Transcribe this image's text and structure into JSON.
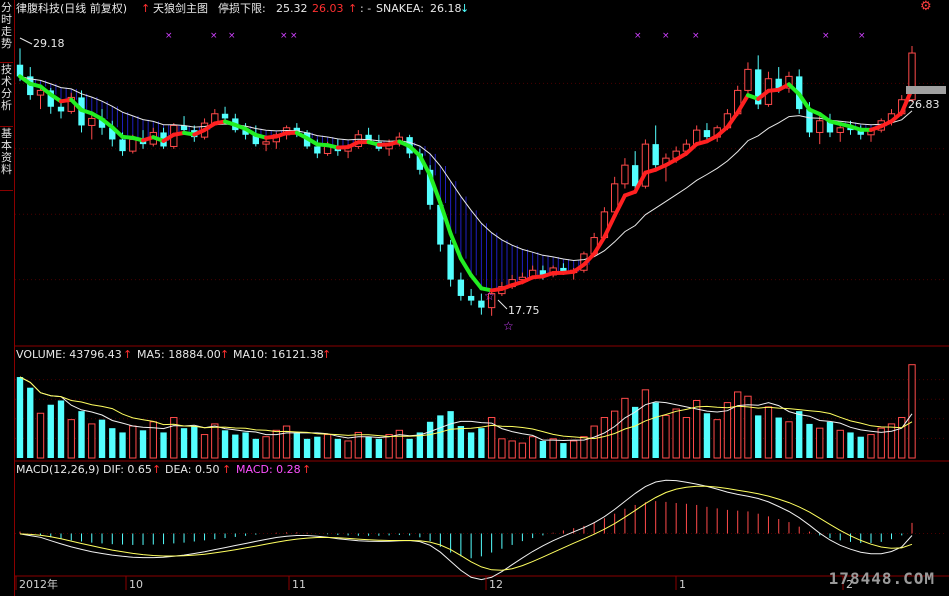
{
  "header": {
    "stock": "律腹科技(日线 前复权)",
    "indicator": "天狼剑主图",
    "stop_label": "停损下限:",
    "stop_value": "25.32",
    "stop_value2": "26.03",
    "snake_label": "SNAKEA:",
    "snake_value": "26.18"
  },
  "side_tabs": [
    "分时走势",
    "技术分析",
    "基本资料"
  ],
  "price_labels": {
    "high": "29.18",
    "low": "17.75",
    "last": "26.83"
  },
  "volume_header": {
    "volume": "VOLUME: 43796.43",
    "ma5": "MA5: 18884.00",
    "ma10": "MA10: 16121.38"
  },
  "macd_header": {
    "title": "MACD(12,26,9)",
    "dif": "DIF: 0.65",
    "dea": "DEA: 0.50",
    "macd": "MACD: 0.28"
  },
  "x_axis": {
    "labels": [
      "2012年",
      "10",
      "11",
      "12",
      "1",
      "2"
    ]
  },
  "watermark": "178448.COM",
  "colors": {
    "up": "#ff4a4a",
    "down": "#54ffff",
    "line": "#e8e8e8",
    "bull": "#ff2020",
    "bear": "#22ee22",
    "frame": "#8a0000"
  },
  "chart_data": [
    {
      "type": "candlestick",
      "title": "天狼剑主图",
      "ylim": [
        16.5,
        30.5
      ],
      "ohlc": [
        [
          28.5,
          29.2,
          27.8,
          28.0
        ],
        [
          28.0,
          28.4,
          27.0,
          27.2
        ],
        [
          27.2,
          27.6,
          26.6,
          27.4
        ],
        [
          27.4,
          27.5,
          26.4,
          26.7
        ],
        [
          26.7,
          27.0,
          26.2,
          26.5
        ],
        [
          26.5,
          27.3,
          26.4,
          27.1
        ],
        [
          27.1,
          27.4,
          25.6,
          25.9
        ],
        [
          25.9,
          26.5,
          25.3,
          26.2
        ],
        [
          26.2,
          26.6,
          25.5,
          25.8
        ],
        [
          25.8,
          26.1,
          25.0,
          25.3
        ],
        [
          25.3,
          25.6,
          24.6,
          24.8
        ],
        [
          24.8,
          25.5,
          24.7,
          25.3
        ],
        [
          25.3,
          25.7,
          24.9,
          25.1
        ],
        [
          25.1,
          25.8,
          25.0,
          25.6
        ],
        [
          25.6,
          25.8,
          24.9,
          25.0
        ],
        [
          25.0,
          26.0,
          24.9,
          25.9
        ],
        [
          25.9,
          26.3,
          25.5,
          25.7
        ],
        [
          25.7,
          25.9,
          25.2,
          25.4
        ],
        [
          25.4,
          26.2,
          25.3,
          26.0
        ],
        [
          26.0,
          26.6,
          25.9,
          26.4
        ],
        [
          26.4,
          26.7,
          26.0,
          26.2
        ],
        [
          26.2,
          26.4,
          25.6,
          25.7
        ],
        [
          25.7,
          26.0,
          25.3,
          25.5
        ],
        [
          25.5,
          25.9,
          25.0,
          25.1
        ],
        [
          25.1,
          25.4,
          24.8,
          25.2
        ],
        [
          25.2,
          25.6,
          24.9,
          25.5
        ],
        [
          25.5,
          25.9,
          25.3,
          25.8
        ],
        [
          25.8,
          26.0,
          25.4,
          25.6
        ],
        [
          25.6,
          25.7,
          24.9,
          25.0
        ],
        [
          25.0,
          25.3,
          24.5,
          24.7
        ],
        [
          24.7,
          25.2,
          24.6,
          25.0
        ],
        [
          25.0,
          25.3,
          24.6,
          24.8
        ],
        [
          24.8,
          25.1,
          24.5,
          25.0
        ],
        [
          25.0,
          25.7,
          24.9,
          25.5
        ],
        [
          25.5,
          25.8,
          25.1,
          25.2
        ],
        [
          25.2,
          25.5,
          24.8,
          24.9
        ],
        [
          24.9,
          25.3,
          24.6,
          25.1
        ],
        [
          25.1,
          25.6,
          25.0,
          25.4
        ],
        [
          25.4,
          25.5,
          24.5,
          24.7
        ],
        [
          24.7,
          24.9,
          23.8,
          24.0
        ],
        [
          24.0,
          24.2,
          22.3,
          22.5
        ],
        [
          22.5,
          22.8,
          20.5,
          20.8
        ],
        [
          20.8,
          21.0,
          19.0,
          19.3
        ],
        [
          19.3,
          19.6,
          18.4,
          18.6
        ],
        [
          18.6,
          18.9,
          18.2,
          18.4
        ],
        [
          18.4,
          18.7,
          17.8,
          18.1
        ],
        [
          18.1,
          18.9,
          17.75,
          18.7
        ],
        [
          18.7,
          19.2,
          18.6,
          19.0
        ],
        [
          19.0,
          19.5,
          18.9,
          19.3
        ],
        [
          19.3,
          19.6,
          19.1,
          19.4
        ],
        [
          19.4,
          19.9,
          19.3,
          19.7
        ],
        [
          19.7,
          19.9,
          19.3,
          19.5
        ],
        [
          19.5,
          19.9,
          19.4,
          19.8
        ],
        [
          19.8,
          20.0,
          19.5,
          19.6
        ],
        [
          19.6,
          19.8,
          19.3,
          19.7
        ],
        [
          19.7,
          20.5,
          19.6,
          20.4
        ],
        [
          20.4,
          21.3,
          20.3,
          21.1
        ],
        [
          21.1,
          22.4,
          21.0,
          22.2
        ],
        [
          22.2,
          23.7,
          22.1,
          23.4
        ],
        [
          23.4,
          24.5,
          23.2,
          24.2
        ],
        [
          24.2,
          24.8,
          23.0,
          23.3
        ],
        [
          23.3,
          25.3,
          23.2,
          25.1
        ],
        [
          25.1,
          25.9,
          24.0,
          24.2
        ],
        [
          24.2,
          24.7,
          23.5,
          24.5
        ],
        [
          24.5,
          25.0,
          24.3,
          24.8
        ],
        [
          24.8,
          25.3,
          24.6,
          25.1
        ],
        [
          25.1,
          25.9,
          25.0,
          25.7
        ],
        [
          25.7,
          26.0,
          25.3,
          25.4
        ],
        [
          25.4,
          25.9,
          25.2,
          25.8
        ],
        [
          25.8,
          26.6,
          25.7,
          26.4
        ],
        [
          26.4,
          27.6,
          26.3,
          27.4
        ],
        [
          27.4,
          28.6,
          27.2,
          28.3
        ],
        [
          28.3,
          28.9,
          26.6,
          26.8
        ],
        [
          26.8,
          28.2,
          26.7,
          27.9
        ],
        [
          27.9,
          28.4,
          27.3,
          27.5
        ],
        [
          27.5,
          28.2,
          27.3,
          28.0
        ],
        [
          28.0,
          28.3,
          26.4,
          26.6
        ],
        [
          26.6,
          26.9,
          25.4,
          25.6
        ],
        [
          25.6,
          26.3,
          25.1,
          26.1
        ],
        [
          26.1,
          26.4,
          25.4,
          25.6
        ],
        [
          25.6,
          26.0,
          25.2,
          25.8
        ],
        [
          25.8,
          26.1,
          25.5,
          25.7
        ],
        [
          25.7,
          25.9,
          25.3,
          25.5
        ],
        [
          25.5,
          25.8,
          25.2,
          25.7
        ],
        [
          25.7,
          26.2,
          25.6,
          26.1
        ],
        [
          26.1,
          26.6,
          25.9,
          26.4
        ],
        [
          26.4,
          27.2,
          26.3,
          27.0
        ],
        [
          27.0,
          29.3,
          26.9,
          29.0
        ]
      ]
    },
    {
      "type": "bar",
      "title": "VOLUME",
      "ylim": [
        0,
        46000
      ],
      "values": [
        38000,
        33000,
        21000,
        25000,
        27000,
        18000,
        22000,
        16000,
        18000,
        14000,
        12000,
        15000,
        13000,
        17000,
        12000,
        19000,
        14000,
        15000,
        11000,
        16000,
        13000,
        11000,
        12000,
        9000,
        10000,
        13000,
        15000,
        12000,
        9000,
        10000,
        11000,
        9000,
        8000,
        12000,
        10000,
        9000,
        11000,
        13000,
        9000,
        12000,
        17000,
        20000,
        22000,
        15000,
        12000,
        14000,
        19000,
        9000,
        8000,
        7000,
        10000,
        8000,
        9000,
        7000,
        8000,
        10000,
        15000,
        19000,
        22000,
        28000,
        24000,
        32000,
        26000,
        20000,
        23000,
        19000,
        27000,
        21000,
        18000,
        26000,
        31000,
        29000,
        20000,
        24000,
        19000,
        17000,
        22000,
        16000,
        14000,
        17000,
        13000,
        12000,
        10000,
        11000,
        14000,
        16000,
        19000,
        43796
      ]
    },
    {
      "type": "bar",
      "title": "MACD(12,26,9)",
      "ylim": [
        -1.3,
        1.3
      ],
      "values": [
        0.05,
        0.0,
        -0.05,
        -0.1,
        -0.14,
        -0.18,
        -0.21,
        -0.24,
        -0.26,
        -0.28,
        -0.29,
        -0.3,
        -0.3,
        -0.29,
        -0.28,
        -0.26,
        -0.24,
        -0.21,
        -0.18,
        -0.15,
        -0.12,
        -0.09,
        -0.06,
        -0.03,
        0.0,
        0.02,
        0.03,
        0.03,
        0.02,
        0.0,
        -0.02,
        -0.04,
        -0.05,
        -0.06,
        -0.06,
        -0.06,
        -0.05,
        -0.04,
        -0.05,
        -0.1,
        -0.2,
        -0.35,
        -0.5,
        -0.6,
        -0.65,
        -0.6,
        -0.5,
        -0.4,
        -0.3,
        -0.2,
        -0.12,
        -0.05,
        0.02,
        0.08,
        0.14,
        0.2,
        0.3,
        0.4,
        0.52,
        0.65,
        0.75,
        0.82,
        0.85,
        0.83,
        0.8,
        0.78,
        0.75,
        0.7,
        0.66,
        0.62,
        0.6,
        0.58,
        0.52,
        0.45,
        0.38,
        0.3,
        0.18,
        0.05,
        -0.05,
        -0.12,
        -0.18,
        -0.22,
        -0.25,
        -0.25,
        -0.22,
        -0.15,
        -0.05,
        0.28
      ]
    }
  ]
}
